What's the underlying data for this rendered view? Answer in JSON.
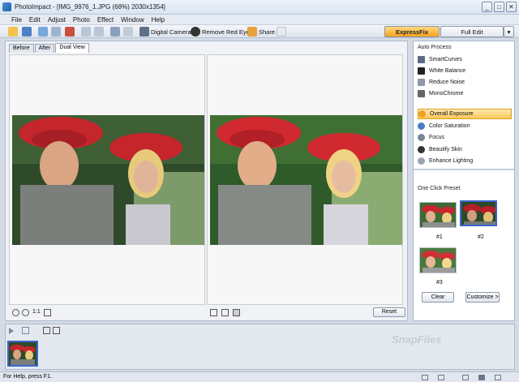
{
  "window": {
    "title": "PhotoImpact - [IMG_9976_1.JPG (68%) 2030x1354]",
    "controls": [
      "_",
      "□",
      "✕"
    ]
  },
  "menu": [
    "File",
    "Edit",
    "Adjust",
    "Photo",
    "Effect",
    "Window",
    "Help"
  ],
  "toolbar": {
    "digital_camera": "Digital Camera",
    "remove_red_eye": "Remove Red Eye",
    "share": "Share",
    "tab_expressfix": "ExpressFix",
    "tab_fulledit": "Full Edit"
  },
  "view_tabs": [
    "Before",
    "After",
    "Dual View"
  ],
  "workspace": {
    "reset": "Reset",
    "zoom_label": "1:1"
  },
  "auto_process": {
    "title": "Auto Process",
    "items": [
      "SmartCurves",
      "White Balance",
      "Reduce Noise",
      "MonoChrome"
    ]
  },
  "adjustments": {
    "items": [
      "Overall Exposure",
      "Color Saturation",
      "Focus",
      "Beautify Skin",
      "Enhance Lighting"
    ],
    "selected": "Overall Exposure"
  },
  "presets": {
    "title": "One Click Preset",
    "labels": [
      "#1",
      "#2",
      "#3"
    ],
    "clear": "Clear",
    "customize": "Customize >"
  },
  "status": {
    "text": "For Help, press F1."
  },
  "watermark": "SnapFiles",
  "colors": {
    "accent": "#f6a21e",
    "selection": "#3a66c9"
  }
}
